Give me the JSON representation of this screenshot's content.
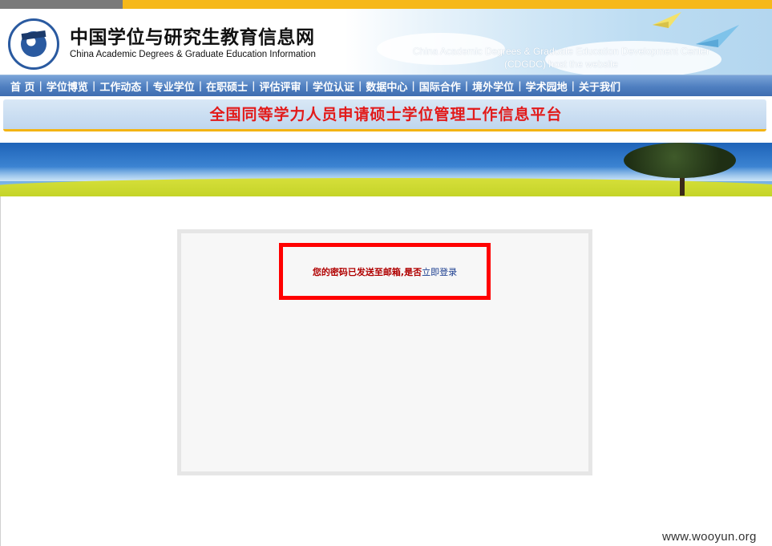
{
  "header": {
    "title_cn": "中国学位与研究生教育信息网",
    "title_en": "China Academic Degrees & Graduate Education Information",
    "host_line1": "China Academic Degrees & Graduate Education Development Center",
    "host_line2": "(CDGDC) host the website"
  },
  "nav": {
    "items": [
      "首  页",
      "学位博览",
      "工作动态",
      "专业学位",
      "在职硕士",
      "评估评审",
      "学位认证",
      "数据中心",
      "国际合作",
      "境外学位",
      "学术园地",
      "关于我们"
    ],
    "separator": "|"
  },
  "platform": {
    "title": "全国同等学力人员申请硕士学位管理工作信息平台"
  },
  "message": {
    "text": "您的密码已发送至邮箱,是否",
    "link": "立即登录"
  },
  "watermark": "www.wooyun.org",
  "colors": {
    "nav_bg": "#4f7fc0",
    "platform_title": "#e21a1a",
    "highlight_border": "#ff0000",
    "message_text": "#b00000",
    "link": "#1a3d8f",
    "top_bar_yellow": "#f6b81a"
  }
}
